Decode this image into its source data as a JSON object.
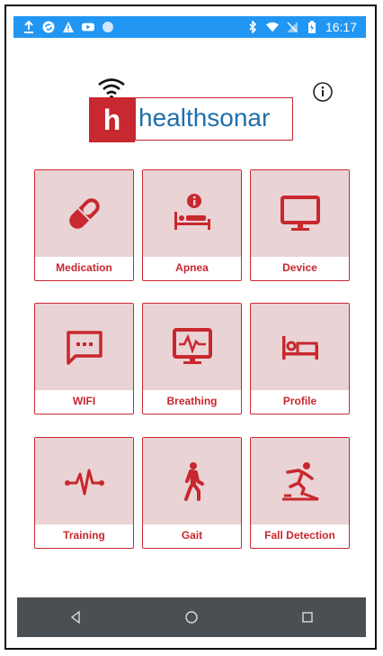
{
  "status_bar": {
    "time": "16:17",
    "left_icons": [
      "upload-icon",
      "sync-icon",
      "warning-icon",
      "youtube-icon",
      "circle-icon"
    ],
    "right_icons": [
      "bluetooth-icon",
      "wifi-icon",
      "no-signal-icon",
      "battery-icon"
    ],
    "color": "#2196f3"
  },
  "logo": {
    "letter": "h",
    "name": "healthsonar",
    "brand_red": "#c8282f",
    "brand_blue": "#1f6fab"
  },
  "info_icon": "info-icon",
  "tiles": [
    {
      "label": "Medication",
      "icon": "pill-icon"
    },
    {
      "label": "Apnea",
      "icon": "bed-info-icon"
    },
    {
      "label": "Device",
      "icon": "monitor-icon"
    },
    {
      "label": "WIFI",
      "icon": "chat-dots-icon"
    },
    {
      "label": "Breathing",
      "icon": "monitor-pulse-icon"
    },
    {
      "label": "Profile",
      "icon": "bed-icon"
    },
    {
      "label": "Training",
      "icon": "heartbeat-icon"
    },
    {
      "label": "Gait",
      "icon": "walking-icon"
    },
    {
      "label": "Fall Detection",
      "icon": "fall-icon"
    }
  ],
  "nav_bar": {
    "buttons": [
      "back-icon",
      "home-icon",
      "recents-icon"
    ],
    "color": "#4a4f53"
  }
}
